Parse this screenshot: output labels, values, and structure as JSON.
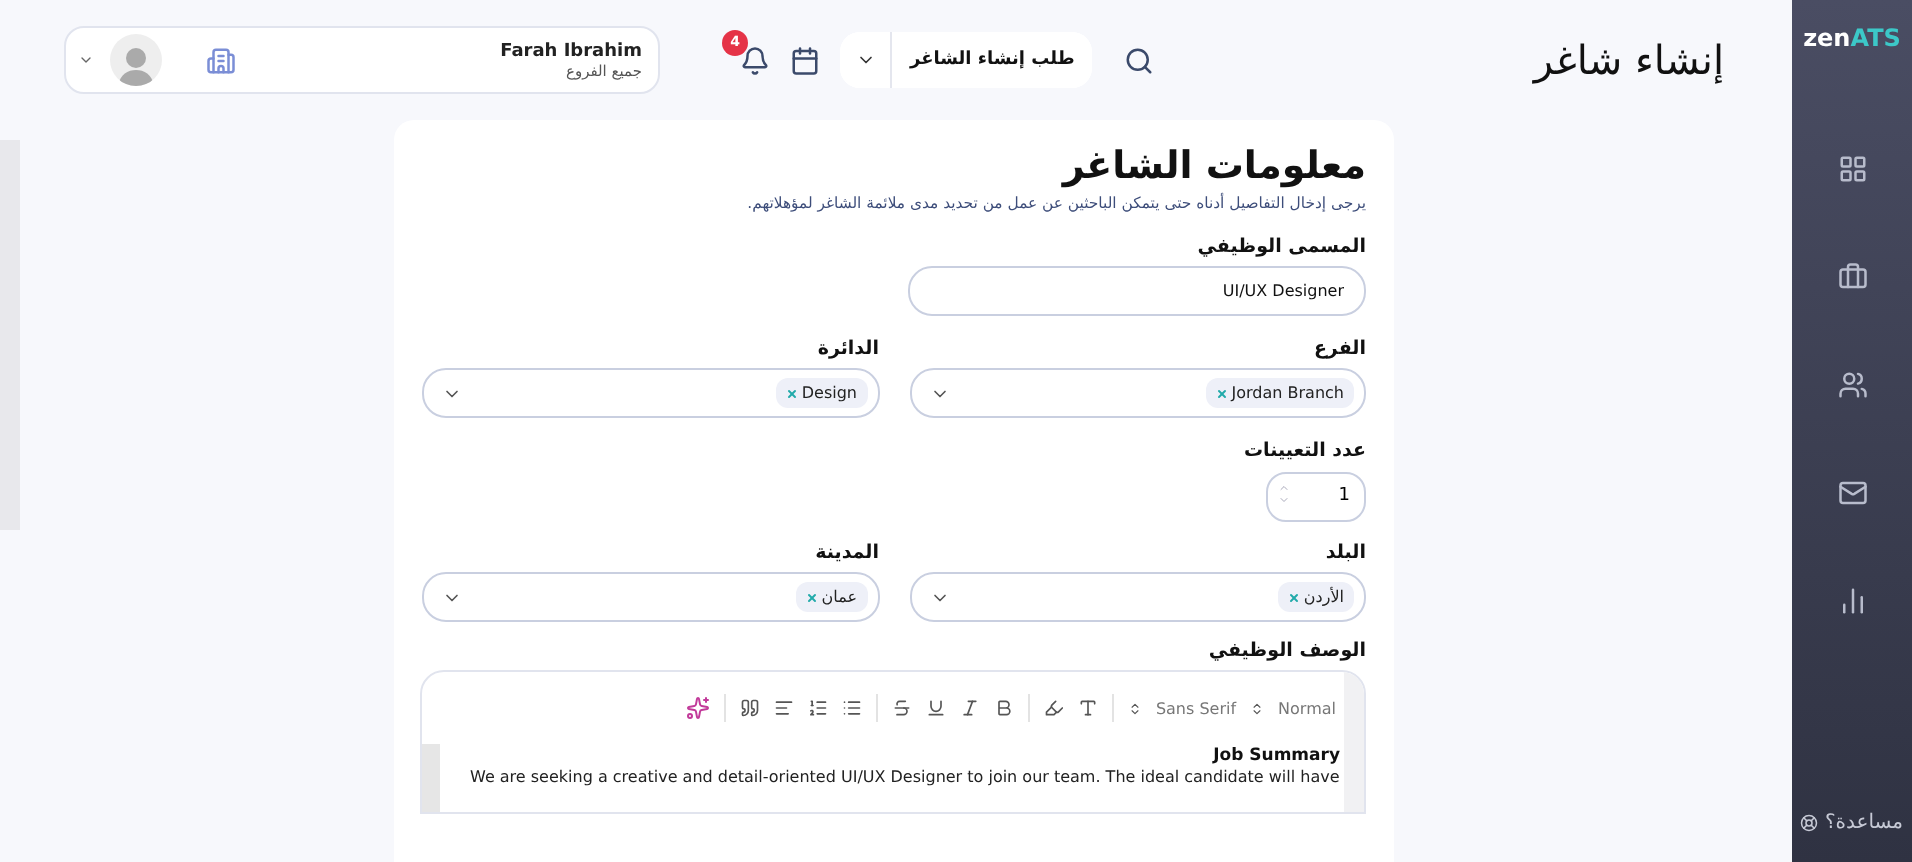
{
  "brand": {
    "part_1": "zen",
    "part_2": "ATS"
  },
  "page_title": "إنشاء شاغر",
  "header": {
    "request_menu": "طلب إنشاء الشاغر",
    "notifications": "4",
    "user": {
      "name": "Farah Ibrahim",
      "branch": "جميع الفروع"
    }
  },
  "sidebar": {
    "items": [
      {
        "selected": false
      },
      {
        "selected": false
      },
      {
        "selected": false
      },
      {
        "selected": false
      },
      {
        "selected": false
      }
    ],
    "help": "مساعدة؟"
  },
  "form": {
    "title": "معلومات الشاغر",
    "subtitle": "يرجى إدخال التفاصيل أدناه حتى يتمكن الباحثين عن عمل من تحديد مدى ملائمة الشاغر لمؤهلاتهم.",
    "rows": [
      [
        {
          "kind": "text",
          "label": "المسمى الوظيفي",
          "value": "UI/UX Designer"
        }
      ],
      [
        {
          "kind": "select",
          "label": "الفرع",
          "tags": [
            "Jordan Branch"
          ]
        },
        {
          "kind": "select",
          "label": "الدائرة",
          "tags": [
            "Design"
          ]
        }
      ],
      [
        {
          "kind": "number",
          "label": "عدد التعيينات",
          "value": "1"
        }
      ],
      [
        {
          "kind": "select",
          "label": "البلد",
          "tags": [
            "الأردن"
          ]
        },
        {
          "kind": "select",
          "label": "المدينة",
          "tags": [
            "عمان"
          ]
        }
      ]
    ],
    "description": {
      "label": "الوصف الوظيفي",
      "size": "Normal",
      "font": "Sans Serif",
      "heading": "Job Summary",
      "text": "We are seeking a creative and detail-oriented UI/UX Designer to join our team. The ideal candidate will have"
    }
  }
}
